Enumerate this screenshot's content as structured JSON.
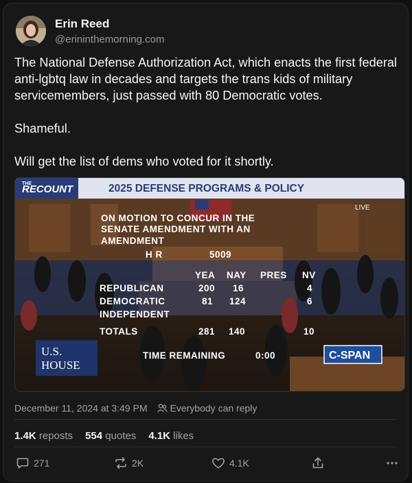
{
  "author": {
    "name": "Erin Reed",
    "handle": "@erininthemorning.com"
  },
  "post": {
    "text_1": "The National Defense Authorization Act, which enacts the first federal anti-lgbtq law in decades and targets the trans kids of military servicemembers, just passed with 80 Democratic votes.",
    "text_2": "Shameful.",
    "text_3": "Will get the list of dems who voted for it shortly."
  },
  "media": {
    "brand_top": "THE",
    "brand": "RECOUNT",
    "headline": "2025 DEFENSE PROGRAMS & POLICY",
    "live": "LIVE",
    "motion_1": "ON MOTION TO CONCUR IN THE",
    "motion_2": "SENATE AMENDMENT WITH AN",
    "motion_3": "AMENDMENT",
    "bill_label": "H R",
    "bill_number": "5009",
    "col_yea": "YEA",
    "col_nay": "NAY",
    "col_pres": "PRES",
    "col_nv": "NV",
    "row_rep": "REPUBLICAN",
    "rep_yea": "200",
    "rep_nay": "16",
    "rep_nv": "4",
    "row_dem": "DEMOCRATIC",
    "dem_yea": "81",
    "dem_nay": "124",
    "dem_nv": "6",
    "row_ind": "INDEPENDENT",
    "row_tot": "TOTALS",
    "tot_yea": "281",
    "tot_nay": "140",
    "tot_nv": "10",
    "time_label": "TIME REMAINING",
    "time_value": "0:00",
    "house_1": "U.S.",
    "house_2": "HOUSE",
    "network": "C-SPAN"
  },
  "meta": {
    "timestamp": "December 11, 2024 at 3:49 PM",
    "reply_setting": "Everybody can reply"
  },
  "stats": {
    "reposts_count": "1.4K",
    "reposts_label": "reposts",
    "quotes_count": "554",
    "quotes_label": "quotes",
    "likes_count": "4.1K",
    "likes_label": "likes"
  },
  "actions": {
    "reply_count": "271",
    "repost_count": "2K",
    "like_count": "4.1K"
  }
}
